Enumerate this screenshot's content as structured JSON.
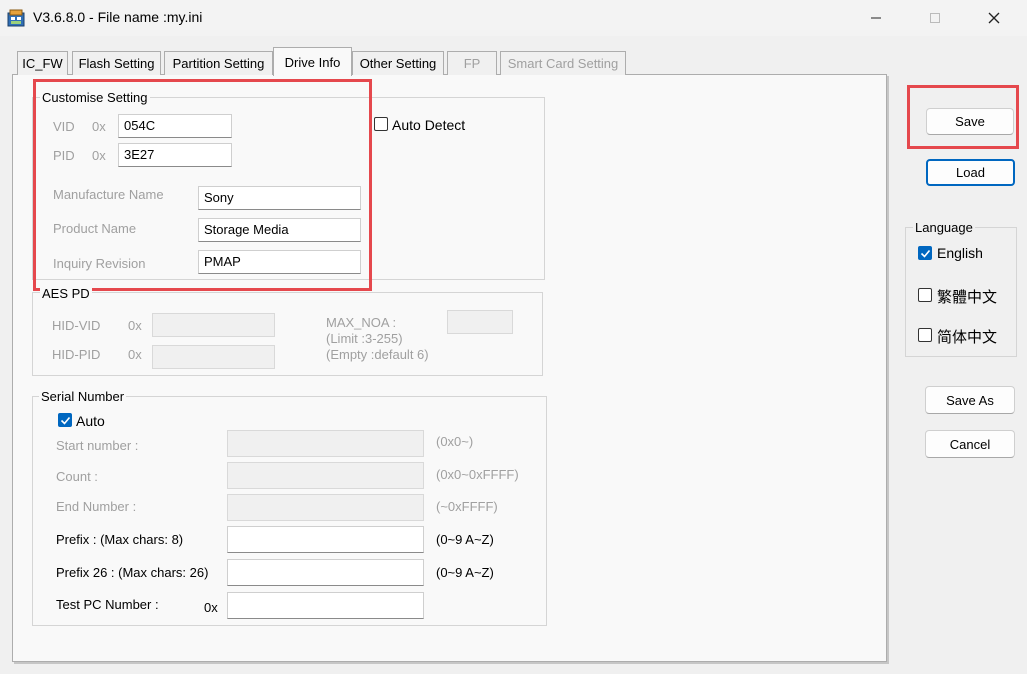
{
  "window": {
    "title": "V3.6.8.0 - File name :my.ini",
    "app_icon": "app-icon",
    "controls": [
      "minimize-icon",
      "maximize-icon",
      "close-icon"
    ]
  },
  "tabs": [
    {
      "label": "IC_FW"
    },
    {
      "label": "Flash Setting"
    },
    {
      "label": "Partition Setting"
    },
    {
      "label": "Drive Info",
      "active": true
    },
    {
      "label": "Other Setting"
    },
    {
      "label": "FP",
      "disabled": true
    },
    {
      "label": "Smart Card Setting",
      "disabled": true
    }
  ],
  "customise": {
    "title": "Customise Setting",
    "vid_label": "VID",
    "pid_label": "PID",
    "hex_prefix": "0x",
    "vid_value": "054C",
    "pid_value": "3E27",
    "manufacture_label": "Manufacture Name",
    "manufacture_value": "Sony",
    "product_label": "Product Name",
    "product_value": "Storage Media",
    "inquiry_label": "Inquiry Revision",
    "inquiry_value": "PMAP",
    "auto_detect_label": "Auto Detect",
    "auto_detect_checked": false
  },
  "aes_pd": {
    "title": "AES PD",
    "hid_vid_label": "HID-VID",
    "hid_pid_label": "HID-PID",
    "hex_prefix": "0x",
    "hid_vid_value": "",
    "hid_pid_value": "",
    "max_noa_label": "MAX_NOA :",
    "limit_text": "(Limit :3-255)",
    "empty_text": "(Empty :default 6)",
    "max_noa_value": ""
  },
  "serial": {
    "title": "Serial Number",
    "auto_label": "Auto",
    "auto_checked": true,
    "start_label": "Start number :",
    "start_hint": "(0x0~)",
    "count_label": "Count :",
    "count_hint": "(0x0~0xFFFF)",
    "end_label": "End Number :",
    "end_hint": "(~0xFFFF)",
    "prefix_label": "Prefix : (Max chars: 8)",
    "prefix_hint": "(0~9 A~Z)",
    "prefix26_label": "Prefix 26 : (Max chars: 26)",
    "prefix26_hint": "(0~9 A~Z)",
    "testpc_label": "Test PC Number :",
    "testpc_prefix": "0x",
    "start_value": "",
    "count_value": "",
    "end_value": "",
    "prefix_value": "",
    "prefix26_value": "",
    "testpc_value": ""
  },
  "buttons": {
    "save": "Save",
    "load": "Load",
    "save_as": "Save As",
    "cancel": "Cancel"
  },
  "language": {
    "title": "Language",
    "options": [
      {
        "label": "English",
        "checked": true
      },
      {
        "label": "繁體中文",
        "checked": false
      },
      {
        "label": "简体中文",
        "checked": false
      }
    ]
  },
  "colors": {
    "highlight": "#e5484d",
    "accent": "#0067c0"
  }
}
